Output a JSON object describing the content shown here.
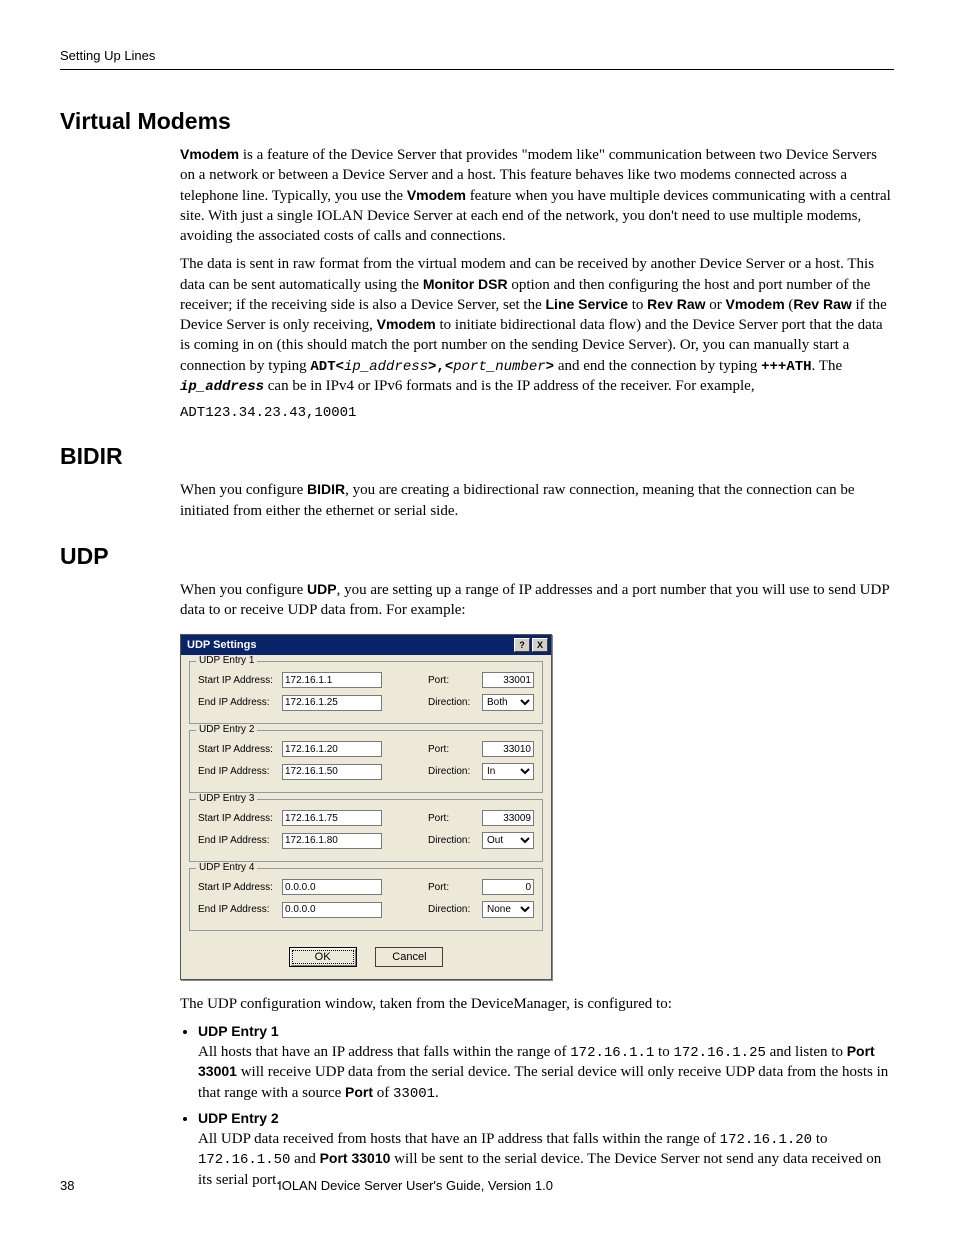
{
  "running_head": "Setting Up Lines",
  "sections": {
    "vmodems": {
      "title": "Virtual Modems",
      "p1_a": "Vmodem",
      "p1_b": " is a feature of the Device Server that provides \"modem like\" communication between two Device Servers on a network or between a Device Server and a host. This feature behaves like two modems connected across a telephone line. Typically, you use the ",
      "p1_c": "Vmodem",
      "p1_d": " feature when you have multiple devices communicating with a central site. With just a single IOLAN Device Server at each end of the network, you don't need to use multiple modems, avoiding the associated costs of calls and connections.",
      "p2_a": "The data is sent in raw format from the virtual modem and can be received by another Device Server or a host. This data can be sent automatically using the ",
      "p2_b": "Monitor DSR",
      "p2_c": " option and then configuring the host and port number of the receiver; if the receiving side is also a Device Server, set the ",
      "p2_d": "Line Service",
      "p2_e": " to ",
      "p2_f": "Rev Raw",
      "p2_g": " or ",
      "p2_h": "Vmodem",
      "p2_i": " (",
      "p2_j": "Rev Raw",
      "p2_k": " if the Device Server is only receiving, ",
      "p2_l": "Vmodem",
      "p2_m": " to initiate bidirectional data flow) and the Device Server port that the data is coming in on (this should match the port number on the sending Device Server). Or, you can manually start a connection by typing ",
      "p2_n": "ADT<",
      "p2_o": "ip_address",
      "p2_p": ">,<",
      "p2_q": "port_number",
      "p2_r": ">",
      "p2_s": " and end the connection by typing ",
      "p2_t": "+++ATH",
      "p2_u": ". The ",
      "p2_v": "ip_address",
      "p2_w": " can be in IPv4 or IPv6 formats and is the IP address of the receiver. For example,",
      "example": "ADT123.34.23.43,10001"
    },
    "bidir": {
      "title": "BIDIR",
      "p1_a": "When you configure ",
      "p1_b": "BIDIR",
      "p1_c": ", you are creating a bidirectional raw connection, meaning that the connection can be initiated from either the ethernet or serial side."
    },
    "udp": {
      "title": "UDP",
      "p1_a": "When you configure ",
      "p1_b": "UDP",
      "p1_c": ", you are setting up a range of IP addresses and a port number that you will use to send UDP data to or receive UDP data from. For example:",
      "after_dlg": "The UDP configuration window, taken from the DeviceManager, is configured to:",
      "bullets": [
        {
          "head": "UDP Entry 1",
          "body_a": "All hosts that have an IP address that falls within the range of ",
          "ip1": "172.16.1.1",
          "body_b": " to ",
          "ip2": "172.16.1.25",
          "body_c": " and listen to ",
          "port_lbl": "Port 33001",
          "body_d": " will receive UDP data from the serial device. The serial device will only receive UDP data from the hosts in that range with a source ",
          "port_lbl2": "Port",
          "body_e": " of ",
          "port_val": "33001",
          "body_f": "."
        },
        {
          "head": "UDP Entry 2",
          "body_a": "All UDP data received from hosts that have an IP address that falls within the range of ",
          "ip1": "172.16.1.20",
          "body_b": " to ",
          "ip2": "172.16.1.50",
          "body_c": " and ",
          "port_lbl": "Port 33010",
          "body_d": " will be sent to the serial device. The Device Server not send any data received on its serial port."
        }
      ]
    }
  },
  "dialog": {
    "title": "UDP Settings",
    "labels": {
      "start_ip": "Start IP Address:",
      "end_ip": "End IP Address:",
      "port": "Port:",
      "direction": "Direction:"
    },
    "entries": [
      {
        "legend": "UDP Entry 1",
        "start_ip": "172.16.1.1",
        "end_ip": "172.16.1.25",
        "port": "33001",
        "direction": "Both"
      },
      {
        "legend": "UDP Entry 2",
        "start_ip": "172.16.1.20",
        "end_ip": "172.16.1.50",
        "port": "33010",
        "direction": "In"
      },
      {
        "legend": "UDP Entry 3",
        "start_ip": "172.16.1.75",
        "end_ip": "172.16.1.80",
        "port": "33009",
        "direction": "Out"
      },
      {
        "legend": "UDP Entry 4",
        "start_ip": "0.0.0.0",
        "end_ip": "0.0.0.0",
        "port": "0",
        "direction": "None"
      }
    ],
    "direction_options": [
      "Both",
      "In",
      "Out",
      "None"
    ],
    "buttons": {
      "ok": "OK",
      "cancel": "Cancel",
      "help": "?",
      "close": "X"
    }
  },
  "footer": {
    "page": "38",
    "text": "IOLAN Device Server User's Guide, Version 1.0"
  }
}
